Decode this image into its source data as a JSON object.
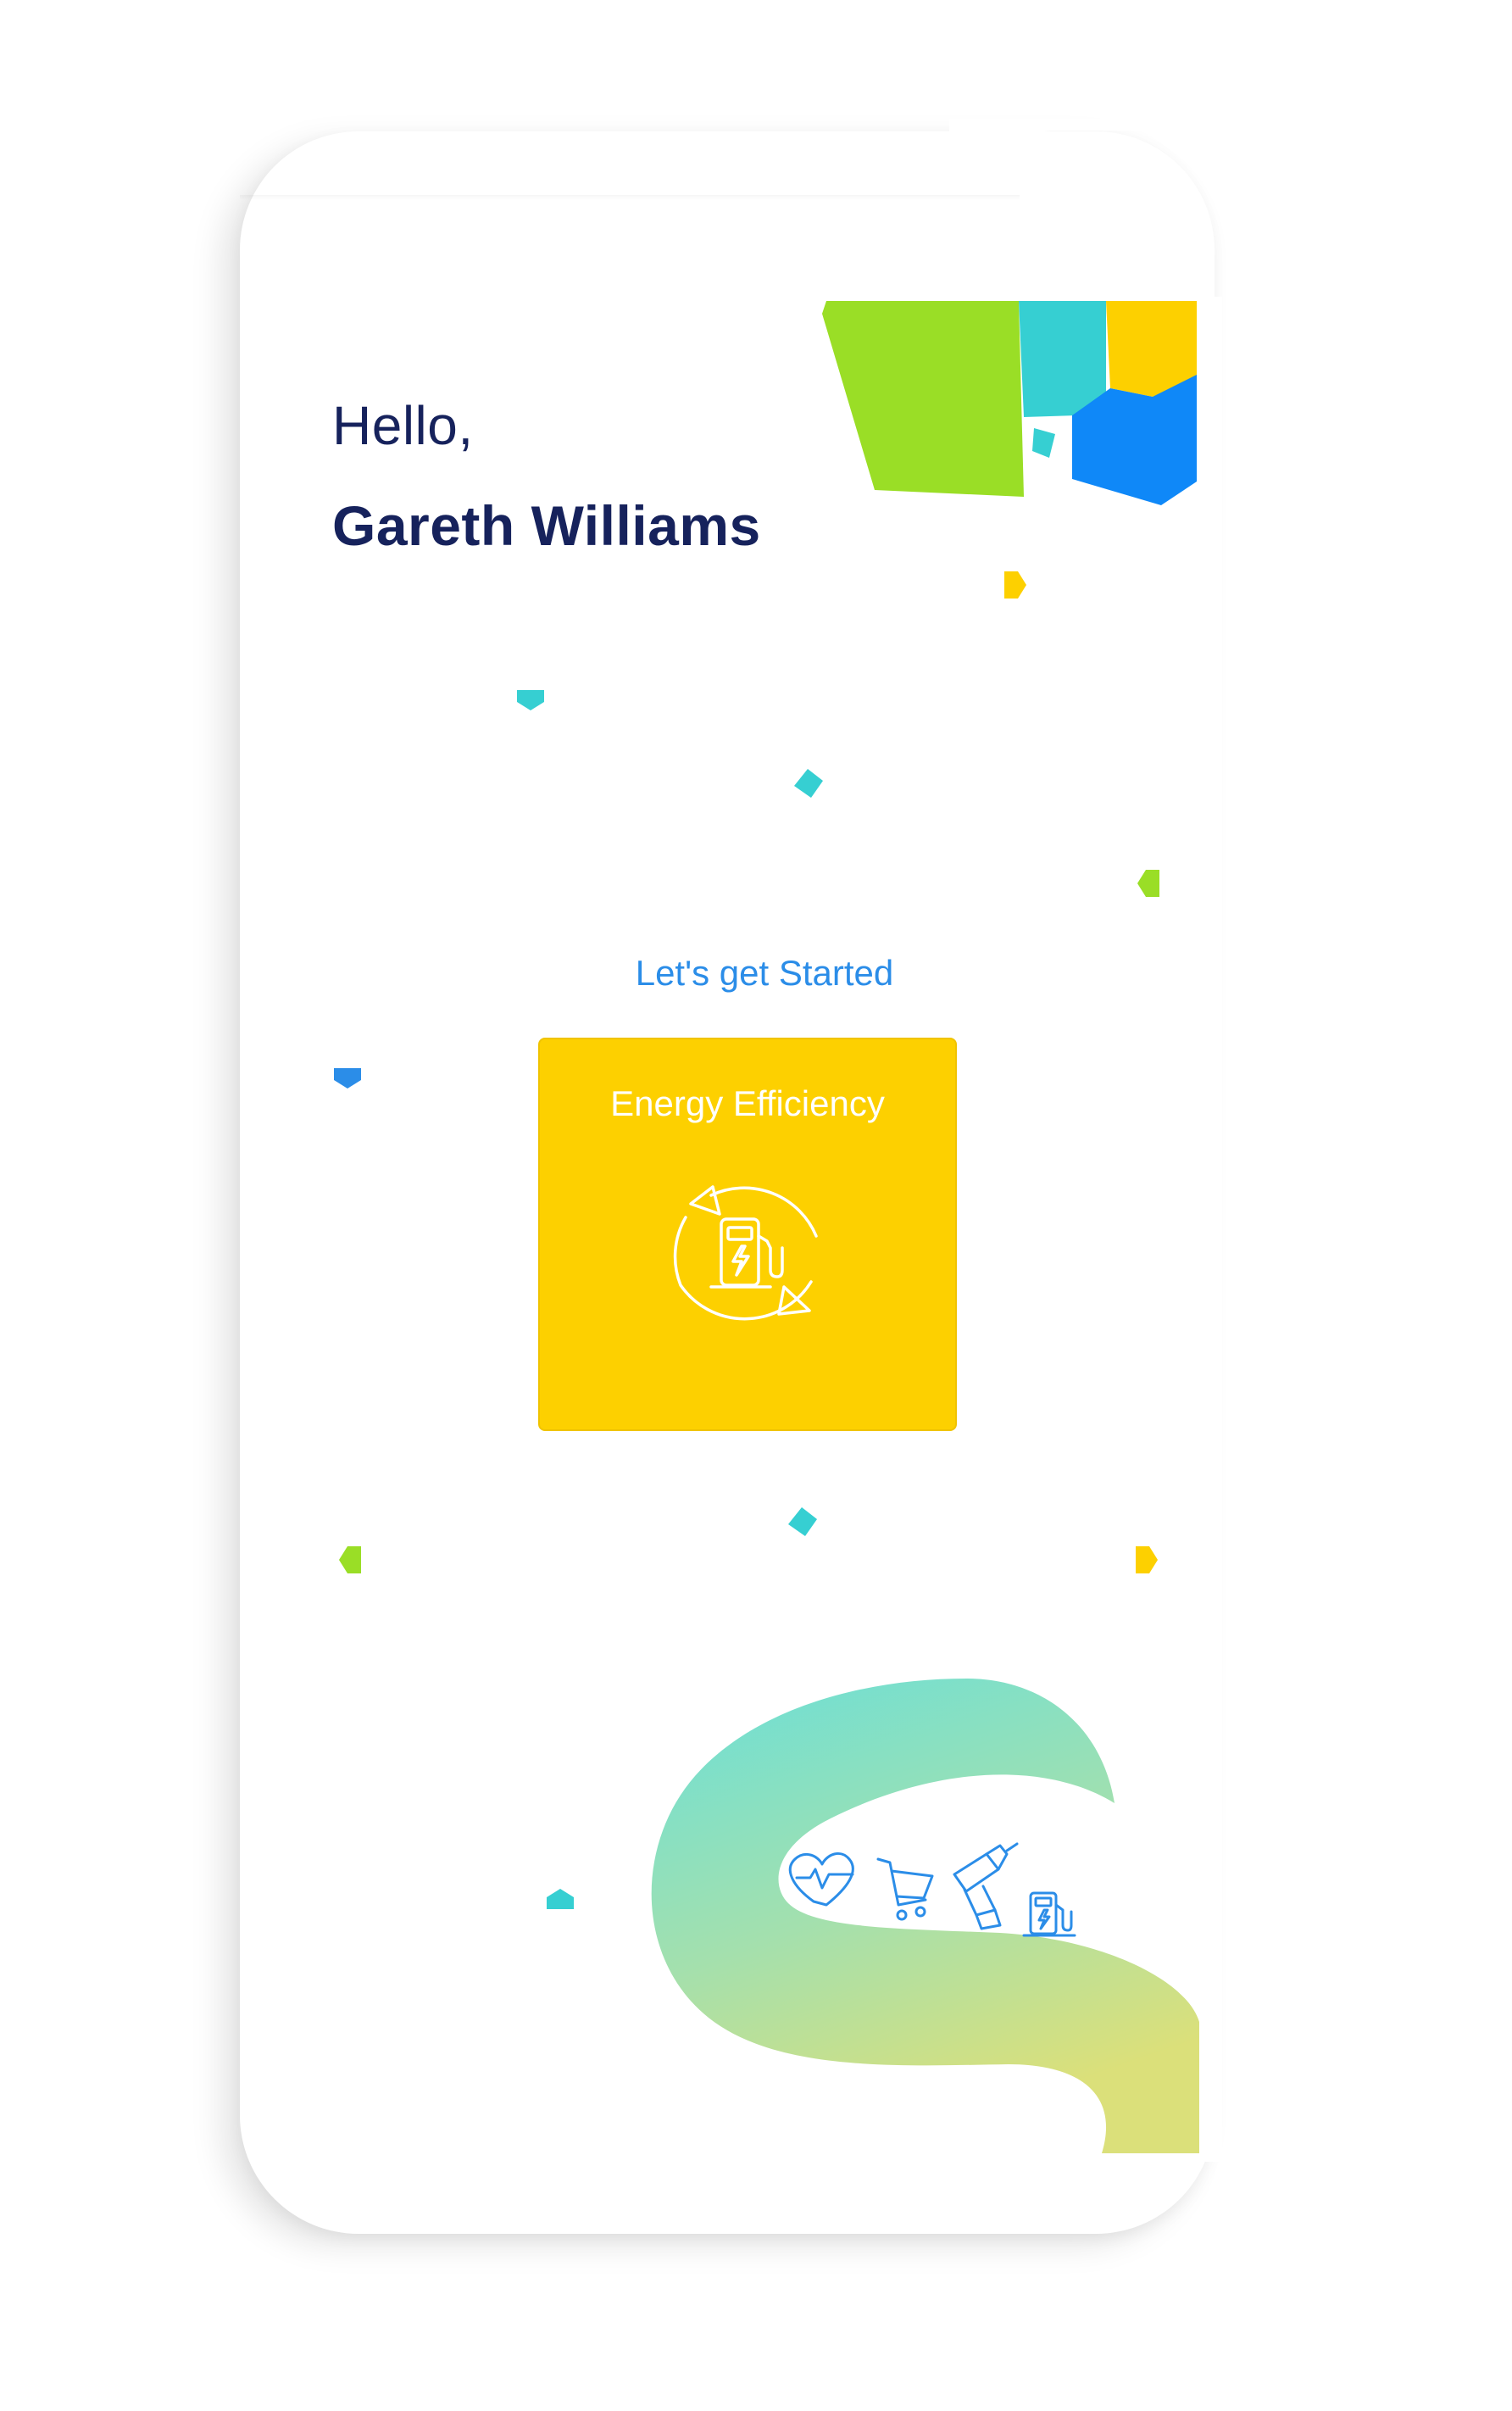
{
  "greeting": {
    "hello": "Hello,",
    "name": "Gareth Williams"
  },
  "main": {
    "subtitle": "Let's get Started",
    "card": {
      "title": "Energy Efficiency",
      "icon": "ev-charger-cycle-icon",
      "color": "#fdd000"
    }
  },
  "illustration": {
    "icons": [
      "heart-pulse-icon",
      "shopping-cart-icon",
      "drill-icon",
      "ev-charger-icon"
    ]
  },
  "colors": {
    "text_dark": "#16225c",
    "accent_blue": "#2b8de8",
    "green": "#9ade26",
    "teal": "#36cfd2",
    "yellow": "#fdd000",
    "blue": "#0f88f8"
  }
}
